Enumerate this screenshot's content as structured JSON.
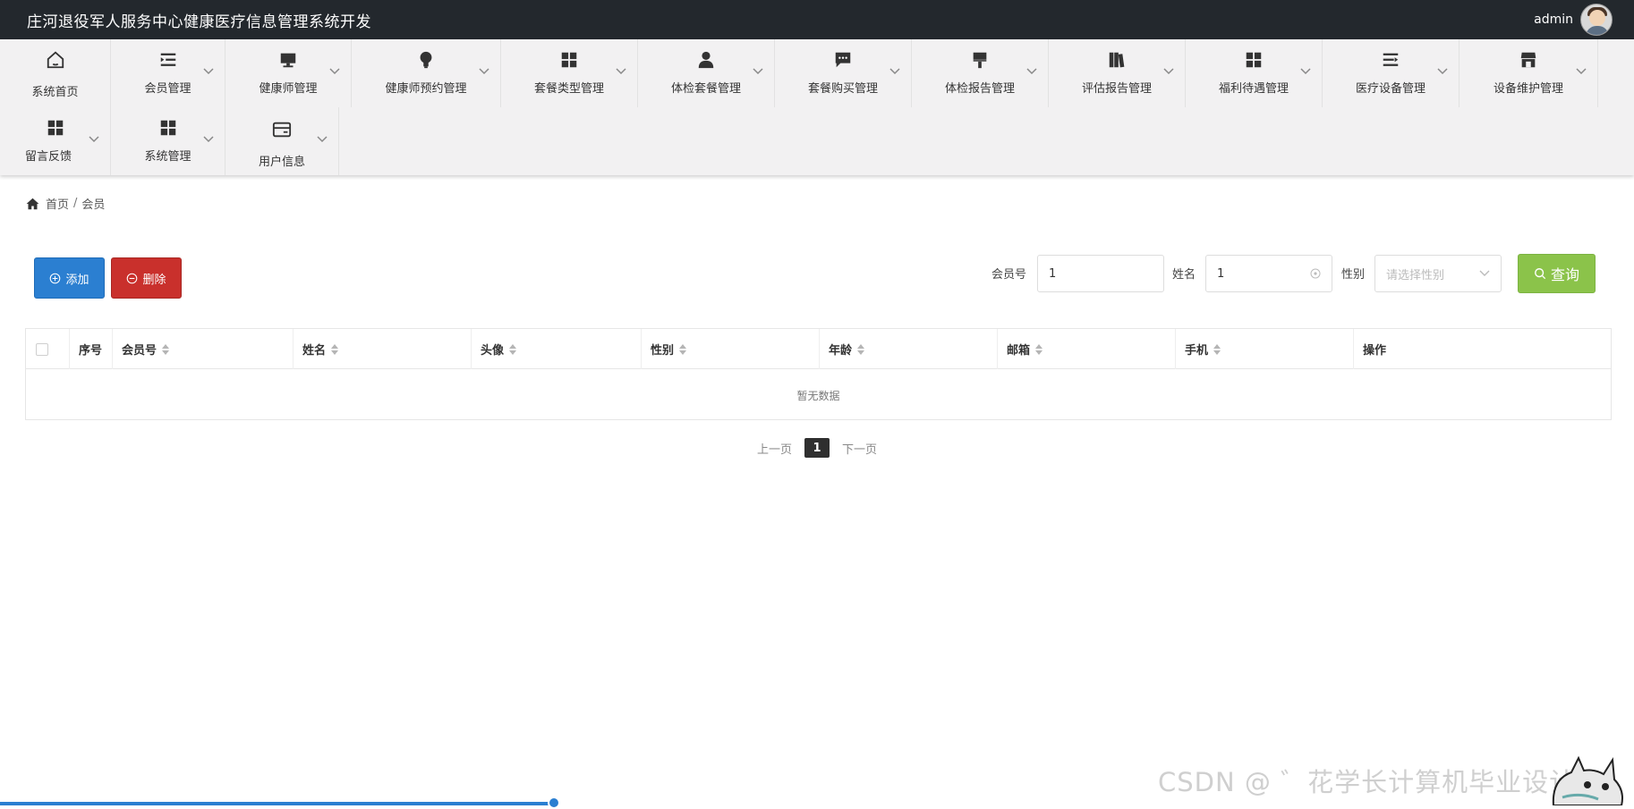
{
  "app": {
    "title": "庄河退役军人服务中心健康医疗信息管理系统开发",
    "user": "admin"
  },
  "nav": [
    {
      "label": "系统首页",
      "icon": "home-icon"
    },
    {
      "label": "会员管理",
      "icon": "list-indent-icon"
    },
    {
      "label": "健康师管理",
      "icon": "monitor-icon"
    },
    {
      "label": "健康师预约管理",
      "icon": "lightbulb-icon"
    },
    {
      "label": "套餐类型管理",
      "icon": "grid-icon"
    },
    {
      "label": "体检套餐管理",
      "icon": "person-icon"
    },
    {
      "label": "套餐购买管理",
      "icon": "chat-icon"
    },
    {
      "label": "体检报告管理",
      "icon": "paint-brush-icon"
    },
    {
      "label": "评估报告管理",
      "icon": "book-icon"
    },
    {
      "label": "福利待遇管理",
      "icon": "grid-icon"
    },
    {
      "label": "医疗设备管理",
      "icon": "list-arrow-icon"
    },
    {
      "label": "设备维护管理",
      "icon": "store-icon"
    },
    {
      "label": "留言反馈",
      "icon": "grid-icon"
    },
    {
      "label": "系统管理",
      "icon": "grid-icon"
    },
    {
      "label": "用户信息",
      "icon": "card-icon"
    }
  ],
  "breadcrumb": {
    "home": "首页",
    "sep": "/",
    "current": "会员"
  },
  "actions": {
    "add": "添加",
    "delete": "删除"
  },
  "search": {
    "member_no_label": "会员号",
    "member_no_value": "1",
    "name_label": "姓名",
    "name_value": "1",
    "gender_label": "性别",
    "gender_placeholder": "请选择性别",
    "submit": "查询"
  },
  "table": {
    "columns": [
      "序号",
      "会员号",
      "姓名",
      "头像",
      "性别",
      "年龄",
      "邮箱",
      "手机",
      "操作"
    ],
    "empty_text": "暂无数据"
  },
  "pagination": {
    "prev": "上一页",
    "current": "1",
    "next": "下一页"
  },
  "watermark": "CSDN @ ゛花学长计算机毕业设计",
  "colors": {
    "topbar": "#23282d",
    "add": "#2b7fd1",
    "delete": "#c9302c",
    "search": "#8bc34a"
  }
}
